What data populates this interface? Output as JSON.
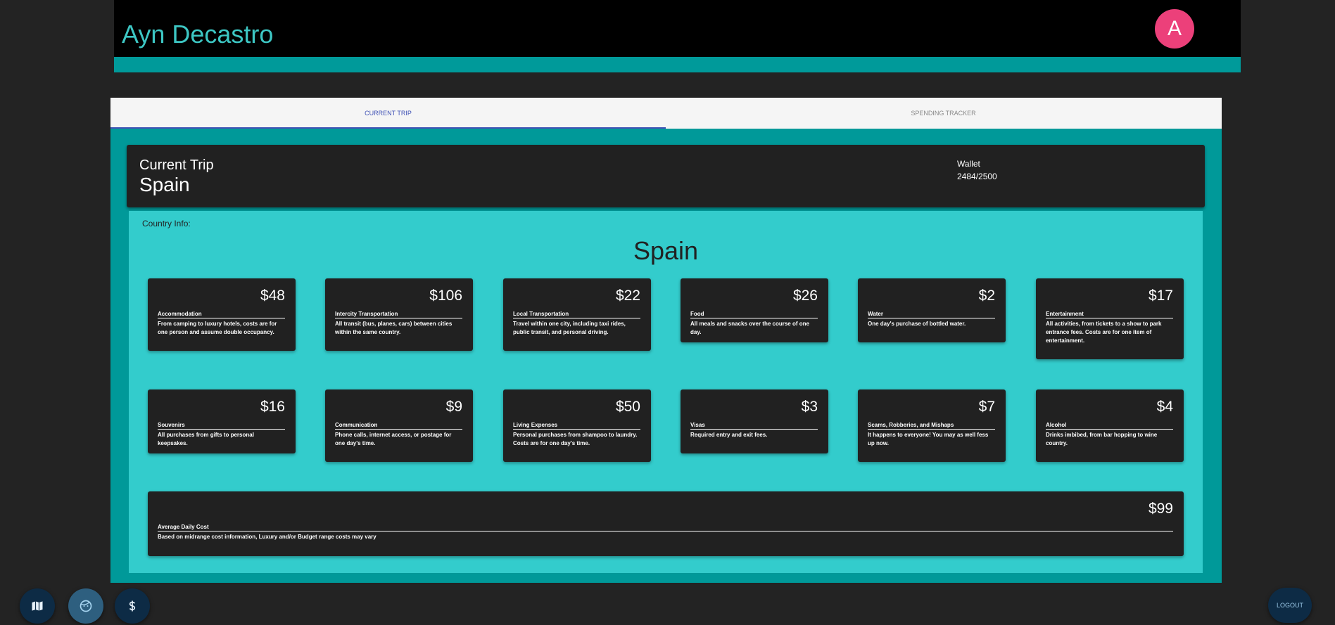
{
  "header": {
    "user_name": "Ayn Decastro",
    "avatar_initial": "A"
  },
  "tabs": [
    {
      "label": "CURRENT TRIP",
      "active": true
    },
    {
      "label": "SPENDING TRACKER",
      "active": false
    }
  ],
  "trip": {
    "label": "Current Trip",
    "country": "Spain",
    "wallet_label": "Wallet",
    "wallet_value": "2484/2500"
  },
  "country_info": {
    "label": "Country Info:",
    "title": "Spain",
    "costs": [
      {
        "price": "$48",
        "title": "Accommodation",
        "desc": "From camping to luxury hotels, costs are for one person and assume double occupancy."
      },
      {
        "price": "$106",
        "title": "Intercity Transportation",
        "desc": "All transit (bus, planes, cars) between cities within the same country."
      },
      {
        "price": "$22",
        "title": "Local Transportation",
        "desc": "Travel within one city, including taxi rides, public transit, and personal driving."
      },
      {
        "price": "$26",
        "title": "Food",
        "desc": "All meals and snacks over the course of one day."
      },
      {
        "price": "$2",
        "title": "Water",
        "desc": "One day's purchase of bottled water."
      },
      {
        "price": "$17",
        "title": "Entertainment",
        "desc": "All activities, from tickets to a show to park entrance fees. Costs are for one item of entertainment."
      },
      {
        "price": "$16",
        "title": "Souvenirs",
        "desc": "All purchases from gifts to personal keepsakes."
      },
      {
        "price": "$9",
        "title": "Communication",
        "desc": "Phone calls, internet access, or postage for one day's time."
      },
      {
        "price": "$50",
        "title": "Living Expenses",
        "desc": "Personal purchases from shampoo to laundry. Costs are for one day's time."
      },
      {
        "price": "$3",
        "title": "Visas",
        "desc": "Required entry and exit fees."
      },
      {
        "price": "$7",
        "title": "Scams, Robberies, and Mishaps",
        "desc": "It happens to everyone! You may as well fess up now."
      },
      {
        "price": "$4",
        "title": "Alcohol",
        "desc": "Drinks imbibed, from bar hopping to wine country."
      }
    ],
    "average": {
      "price": "$99",
      "title": "Average Daily Cost",
      "desc": "Based on midrange cost information, Luxury and/or Budget range costs may vary"
    }
  },
  "nav": {
    "icons": [
      "map-icon",
      "face-icon",
      "dollar-icon"
    ],
    "logout_label": "LOGOUT"
  },
  "colors": {
    "accent": "#3dc7c4",
    "teal_dark": "#009999",
    "teal_light": "#33cccc",
    "avatar": "#ec407a",
    "tab_active": "#3f51b5"
  }
}
